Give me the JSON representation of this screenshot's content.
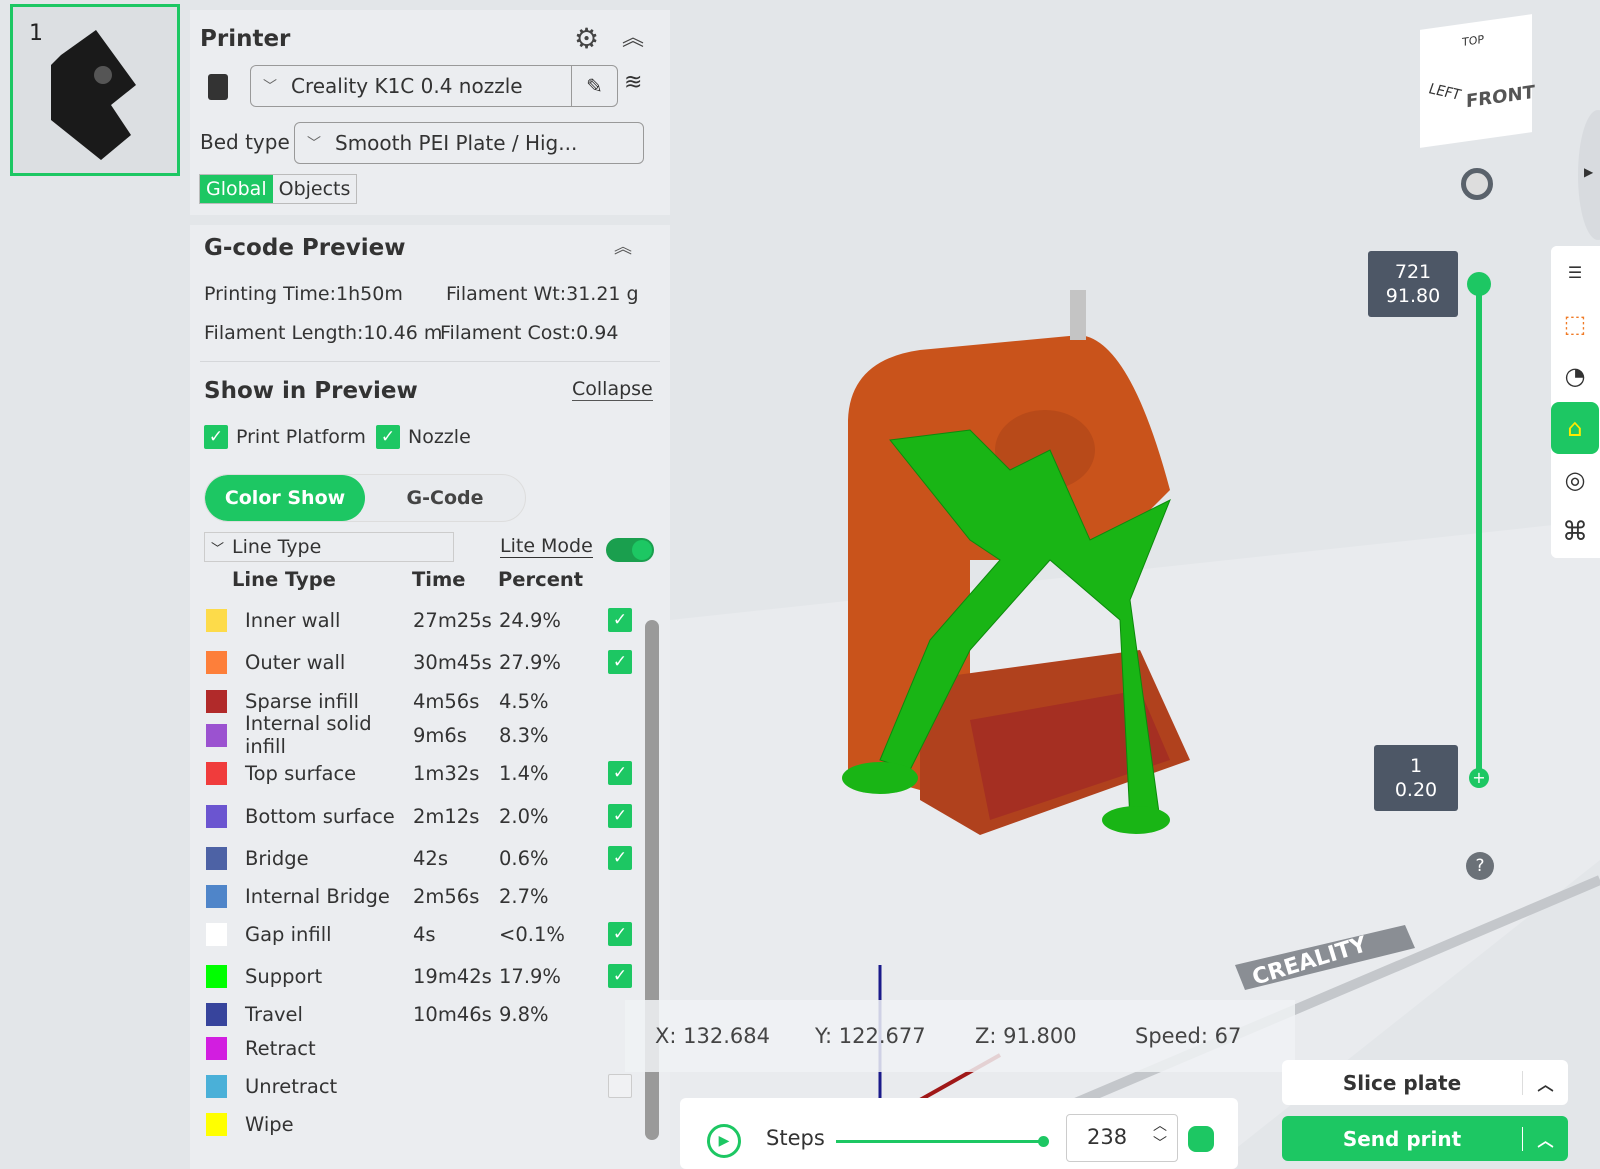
{
  "plate": {
    "number": "1"
  },
  "printer": {
    "title": "Printer",
    "printer_name": "Creality K1C 0.4 nozzle",
    "bed_type_label": "Bed type",
    "bed_type": "Smooth PEI Plate / Hig...",
    "tabs": [
      "Global",
      "Objects"
    ]
  },
  "gcode": {
    "title": "G-code Preview",
    "printing_time": "Printing Time:1h50m",
    "filament_wt": "Filament Wt:31.21 g",
    "filament_length": "Filament Length:10.46 m",
    "filament_cost": "Filament Cost:0.94",
    "show_title": "Show in Preview",
    "collapse": "Collapse",
    "print_platform": "Print Platform",
    "nozzle": "Nozzle",
    "color_show": "Color Show",
    "gcode_btn": "G-Code",
    "view_type": "Line Type",
    "lite_mode": "Lite Mode",
    "headers": [
      "Line Type",
      "Time",
      "Percent"
    ],
    "rows": [
      {
        "name": "Inner wall",
        "time": "27m25s",
        "percent": "24.9%",
        "color": "#fddb4a",
        "checked": true
      },
      {
        "name": "Outer wall",
        "time": "30m45s",
        "percent": "27.9%",
        "color": "#fd7f3a",
        "checked": true
      },
      {
        "name": "Sparse infill",
        "time": "4m56s",
        "percent": "4.5%",
        "color": "#b12a2a",
        "checked": null
      },
      {
        "name": "Internal solid infill",
        "time": "9m6s",
        "percent": "8.3%",
        "color": "#9b52d0",
        "checked": null
      },
      {
        "name": "Top surface",
        "time": "1m32s",
        "percent": "1.4%",
        "color": "#f03c3c",
        "checked": true
      },
      {
        "name": "Bottom surface",
        "time": "2m12s",
        "percent": "2.0%",
        "color": "#6b55d0",
        "checked": true
      },
      {
        "name": "Bridge",
        "time": "42s",
        "percent": "0.6%",
        "color": "#4d62a5",
        "checked": true
      },
      {
        "name": "Internal Bridge",
        "time": "2m56s",
        "percent": "2.7%",
        "color": "#4f85c9",
        "checked": null
      },
      {
        "name": "Gap infill",
        "time": "4s",
        "percent": "<0.1%",
        "color": "#ffffff",
        "checked": true
      },
      {
        "name": "Support",
        "time": "19m42s",
        "percent": "17.9%",
        "color": "#00ff00",
        "checked": true
      },
      {
        "name": "Travel",
        "time": "10m46s",
        "percent": "9.8%",
        "color": "#37449c",
        "checked": null
      },
      {
        "name": "Retract",
        "time": "",
        "percent": "",
        "color": "#d21ee0",
        "checked": null
      },
      {
        "name": "Unretract",
        "time": "",
        "percent": "",
        "color": "#4ab0d8",
        "checked": false
      },
      {
        "name": "Wipe",
        "time": "",
        "percent": "",
        "color": "#ffff00",
        "checked": null
      }
    ]
  },
  "viewport": {
    "cube": {
      "top": "TOP",
      "left": "LEFT",
      "front": "FRONT"
    },
    "layer_top": {
      "layer": "721",
      "height": "91.80"
    },
    "layer_bottom": {
      "layer": "1",
      "height": "0.20"
    },
    "bed_brand": "CREALITY",
    "help": "?",
    "coords": {
      "x": "X: 132.684",
      "y": "Y: 122.677",
      "z": "Z: 91.800",
      "speed": "Speed: 67"
    },
    "steps_label": "Steps",
    "steps_value": "238",
    "steps_progress": 1.0
  },
  "actions": {
    "slice": "Slice plate",
    "send": "Send print"
  },
  "accent": "#1dc763"
}
